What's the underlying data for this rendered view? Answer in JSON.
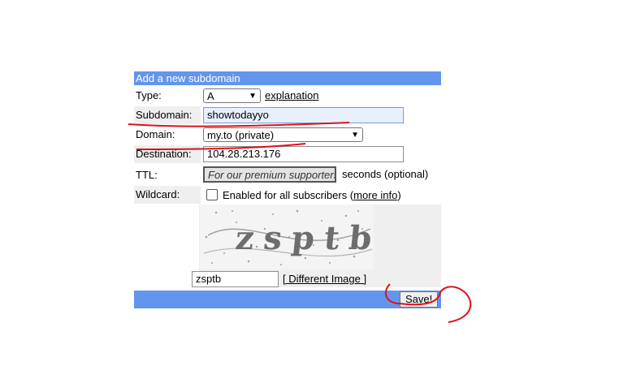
{
  "form": {
    "heading": "Add a new subdomain",
    "type": {
      "label": "Type:",
      "value": "A",
      "explanation_link": "explanation"
    },
    "subdomain": {
      "label": "Subdomain:",
      "value": "showtodayyo"
    },
    "domain": {
      "label": "Domain:",
      "value": "my.to (private)"
    },
    "destination": {
      "label": "Destination:",
      "value": "104.28.213.176"
    },
    "ttl": {
      "label": "TTL:",
      "placeholder": "For our premium supporters",
      "suffix": "seconds (optional)"
    },
    "wildcard": {
      "label": "Wildcard:",
      "checked": false,
      "text_before": "Enabled for all subscribers (",
      "link": "more info",
      "text_after": ")"
    },
    "captcha": {
      "text": "zsptb",
      "value": "zsptb",
      "different_image_link": "[ Different Image ]"
    },
    "save_label": "Save!"
  },
  "colors": {
    "header_bar": "#6495ed",
    "label_bg": "#efefef",
    "annotation": "#e0101a"
  }
}
